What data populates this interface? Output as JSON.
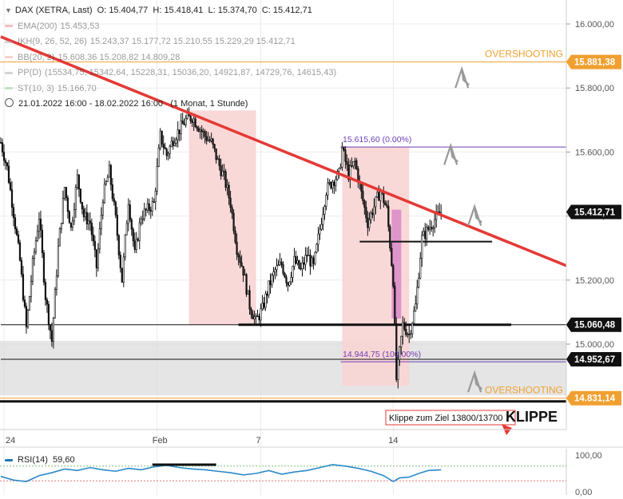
{
  "header": {
    "title": "DAX (XETRA, Last)",
    "ohlc": {
      "open_label": "O:",
      "open": "15.404,77",
      "high_label": "H:",
      "high": "15.418,41",
      "low_label": "L:",
      "low": "15.374,70",
      "close_label": "C:",
      "close": "15.412,71"
    },
    "indicators": [
      {
        "name": "EMA(200)",
        "values": "15.453,53",
        "color": "#e57373"
      },
      {
        "name": "IKH(9, 26, 52, 26)",
        "values": "15.243,37   15.177,72   15.210,55   15.229,29   15.412,71",
        "color": "#9e9e9e"
      },
      {
        "name": "BB(20, 2)",
        "values": "15.608,36   15.208,82   14.809,28",
        "color": "#ef9a9a"
      },
      {
        "name": "PP(D)",
        "values": "(15534,75, 15342,64, 15228,31, 15036,20, 14921,87, 14729,76, 14615,43)",
        "color": "#9e9e9e"
      },
      {
        "name": "ST(10, 3)",
        "values": "15.166,70",
        "color": "#81c784"
      }
    ],
    "range": "21.01.2022 16:00 - 18.02.2022 16:00",
    "interval": "(1 Monat, 1 Stunde)"
  },
  "colors": {
    "trendline": "#e53935",
    "candle": "#111111",
    "pink_zone": "#f8d4d4",
    "support_zone": "#dcdcdc",
    "overshoot": "#f0a030",
    "fib": "#6a3fb5",
    "rsi": "#2a8ac9",
    "rsi_fill": "#e57373"
  },
  "chart_data": [
    {
      "type": "candlestick",
      "title": "DAX (XETRA, Last)",
      "yaxis": {
        "ylim": [
          14830,
          16100
        ],
        "ticks": [
          "16.000,00",
          "15.800,00",
          "15.600,00",
          "15.400,00",
          "15.200,00",
          "15.000,00"
        ],
        "tick_values": [
          16000,
          15800,
          15600,
          15400,
          15200,
          15000
        ],
        "side": "right",
        "grid": true
      },
      "xaxis": {
        "ticks": [
          "24",
          "Feb",
          "7",
          "14"
        ],
        "tick_index": [
          2,
          98,
          163,
          246
        ]
      },
      "price_labels": [
        {
          "text": "15.881,38",
          "value": 15881.38,
          "style": "overshoot"
        },
        {
          "text": "15.412,71",
          "value": 15412.71,
          "style": "current"
        },
        {
          "text": "15.060,48",
          "value": 15060.48,
          "style": "level"
        },
        {
          "text": "14.952,67",
          "value": 14952.67,
          "style": "level"
        },
        {
          "text": "14.831,14",
          "value": 14831.14,
          "style": "overshoot"
        }
      ],
      "annotations": {
        "overshoot_top": {
          "text": "OVERSHOOTING",
          "value": 15881.38
        },
        "overshoot_bottom": {
          "text": "OVERSHOOTING",
          "value": 14831.14
        },
        "fib_high": {
          "text": "15.615,60 (0.00%)",
          "value": 15615.6
        },
        "fib_low": {
          "text": "14.944,75 (100.00%)",
          "value": 14944.75
        },
        "klippe_box": "Klippe zum Ziel 13800/13700",
        "klippe_big": "KLIPPE"
      },
      "trendline": {
        "start": {
          "i": 0,
          "v": 15960
        },
        "end": {
          "i": 355,
          "v": 15245
        }
      },
      "horizontal_levels": [
        {
          "value": 15060.48,
          "i_from": 0,
          "i_to": 355,
          "weight": 1
        },
        {
          "value": 15060.48,
          "i_from": 149,
          "i_to": 320,
          "weight": 3
        },
        {
          "value": 15320,
          "i_from": 225,
          "i_to": 308,
          "weight": 2
        },
        {
          "value": 14952.67,
          "i_from": 0,
          "i_to": 355,
          "weight": 1
        },
        {
          "value": 14944.75,
          "i_from": 213,
          "i_to": 355,
          "weight": 1,
          "style": "fib"
        },
        {
          "value": 15615.6,
          "i_from": 213,
          "i_to": 355,
          "weight": 1,
          "style": "fib"
        }
      ],
      "zones": {
        "support": {
          "from": 14840,
          "to": 15010
        },
        "pink": [
          {
            "i_from": 118,
            "i_to": 160,
            "from": 15060,
            "to": 15730
          },
          {
            "i_from": 214,
            "i_to": 256,
            "from": 14870,
            "to": 15615
          }
        ],
        "magenta": {
          "i_from": 245,
          "i_to": 251,
          "from": 15080,
          "to": 15420
        }
      },
      "arrows": [
        {
          "i": 289,
          "v": 15830,
          "dir": "up"
        },
        {
          "i": 282,
          "v": 15590,
          "dir": "up"
        },
        {
          "i": 297,
          "v": 15400,
          "dir": "up"
        },
        {
          "i": 297,
          "v": 14880,
          "dir": "up"
        }
      ],
      "anchors": [
        [
          0,
          15630
        ],
        [
          4,
          15550
        ],
        [
          8,
          15410
        ],
        [
          12,
          15260
        ],
        [
          16,
          15050
        ],
        [
          20,
          15250
        ],
        [
          24,
          15400
        ],
        [
          28,
          15150
        ],
        [
          32,
          15010
        ],
        [
          36,
          15300
        ],
        [
          40,
          15490
        ],
        [
          44,
          15360
        ],
        [
          48,
          15520
        ],
        [
          52,
          15400
        ],
        [
          56,
          15380
        ],
        [
          60,
          15240
        ],
        [
          64,
          15460
        ],
        [
          68,
          15540
        ],
        [
          72,
          15390
        ],
        [
          76,
          15200
        ],
        [
          80,
          15450
        ],
        [
          84,
          15280
        ],
        [
          88,
          15400
        ],
        [
          92,
          15420
        ],
        [
          96,
          15440
        ],
        [
          100,
          15650
        ],
        [
          104,
          15590
        ],
        [
          108,
          15640
        ],
        [
          112,
          15670
        ],
        [
          116,
          15700
        ],
        [
          120,
          15710
        ],
        [
          124,
          15680
        ],
        [
          128,
          15650
        ],
        [
          132,
          15630
        ],
        [
          136,
          15570
        ],
        [
          140,
          15520
        ],
        [
          144,
          15440
        ],
        [
          148,
          15300
        ],
        [
          152,
          15230
        ],
        [
          156,
          15120
        ],
        [
          160,
          15070
        ],
        [
          164,
          15110
        ],
        [
          168,
          15180
        ],
        [
          172,
          15230
        ],
        [
          176,
          15250
        ],
        [
          180,
          15190
        ],
        [
          184,
          15260
        ],
        [
          188,
          15230
        ],
        [
          192,
          15280
        ],
        [
          196,
          15240
        ],
        [
          200,
          15360
        ],
        [
          204,
          15480
        ],
        [
          208,
          15510
        ],
        [
          212,
          15530
        ],
        [
          214,
          15610
        ],
        [
          218,
          15530
        ],
        [
          222,
          15570
        ],
        [
          226,
          15470
        ],
        [
          230,
          15380
        ],
        [
          234,
          15430
        ],
        [
          238,
          15480
        ],
        [
          242,
          15420
        ],
        [
          246,
          15200
        ],
        [
          248,
          14890
        ],
        [
          252,
          15060
        ],
        [
          256,
          15030
        ],
        [
          260,
          15120
        ],
        [
          264,
          15330
        ],
        [
          268,
          15360
        ],
        [
          272,
          15390
        ],
        [
          276,
          15412
        ]
      ]
    },
    {
      "type": "line",
      "title": "RSI(14)",
      "value_label": "59,60",
      "ylim": [
        0,
        100
      ],
      "ticks": [
        "100,00",
        "0,00"
      ],
      "tick_values": [
        100,
        0
      ],
      "levels": [
        70,
        30
      ],
      "series": [
        {
          "name": "RSI(14)",
          "x": [
            0,
            8,
            16,
            24,
            32,
            40,
            48,
            56,
            64,
            72,
            80,
            88,
            96,
            104,
            112,
            120,
            128,
            136,
            144,
            152,
            160,
            168,
            176,
            184,
            192,
            200,
            208,
            216,
            224,
            232,
            240,
            246,
            250,
            256,
            262,
            268,
            276
          ],
          "values": [
            42,
            32,
            28,
            44,
            52,
            62,
            58,
            66,
            60,
            56,
            64,
            60,
            68,
            72,
            66,
            62,
            60,
            56,
            52,
            46,
            50,
            58,
            48,
            54,
            58,
            66,
            74,
            70,
            64,
            56,
            44,
            28,
            38,
            40,
            50,
            58,
            60
          ]
        }
      ],
      "marker": {
        "i_from": 95,
        "i_to": 135,
        "value": 74
      }
    }
  ]
}
